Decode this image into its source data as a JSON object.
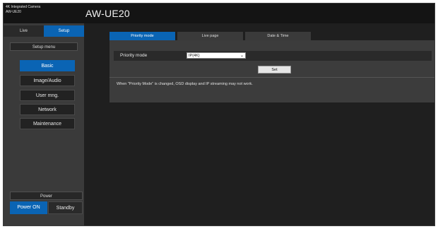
{
  "header": {
    "brand_line1": "4K Integrated Camera",
    "brand_line2": "AW-UE20",
    "model_title": "AW-UE20"
  },
  "sidebar": {
    "mode_tabs": [
      {
        "label": "Live",
        "active": false
      },
      {
        "label": "Setup",
        "active": true
      }
    ],
    "setup_menu_title": "Setup menu",
    "menu_items": [
      {
        "label": "Basic",
        "active": true
      },
      {
        "label": "Image/Audio",
        "active": false
      },
      {
        "label": "User mng.",
        "active": false
      },
      {
        "label": "Network",
        "active": false
      },
      {
        "label": "Maintenance",
        "active": false
      }
    ],
    "power_title": "Power",
    "power_on_label": "Power ON",
    "standby_label": "Standby"
  },
  "main": {
    "tabs": [
      {
        "label": "Priority mode",
        "active": true
      },
      {
        "label": "Live page",
        "active": false
      },
      {
        "label": "Date & Time",
        "active": false
      }
    ],
    "priority_mode_label": "Priority mode",
    "priority_mode_value": "IP(4K)",
    "set_button_label": "Set",
    "notice": "When \"Priority Mode\" is changed, OSD display and IP streaming may not work."
  },
  "colors": {
    "accent": "#0a64b4",
    "background": "#1f1f1f",
    "sidebar": "#3a3a3a"
  }
}
